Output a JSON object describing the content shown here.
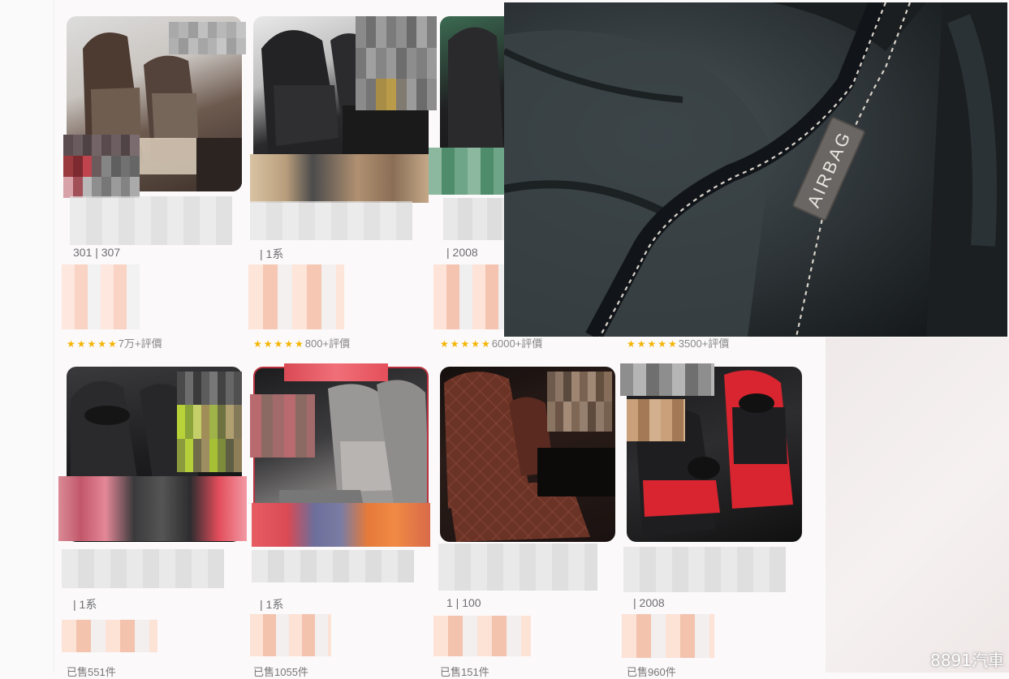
{
  "products_row1": [
    {
      "subtitle": "301 | 307",
      "rating_text": "7万+評價"
    },
    {
      "subtitle": "| 1系",
      "rating_text": "800+評價"
    },
    {
      "subtitle": "| 2008",
      "rating_text": "6000+評價"
    },
    {
      "subtitle": "",
      "rating_text": "3500+評價"
    }
  ],
  "products_row2": [
    {
      "subtitle": "| 1系",
      "sold_text": "已售551件"
    },
    {
      "subtitle": "| 1系",
      "sold_text": "已售1055件"
    },
    {
      "subtitle": "1 | 100",
      "sold_text": "已售151件"
    },
    {
      "subtitle": "| 2008",
      "sold_text": "已售960件"
    }
  ],
  "stars": "★★★★★",
  "overlay": {
    "tag_label": "AIRBAG"
  },
  "watermark": "8891汽車",
  "colors": {
    "star": "#f5b400",
    "accent_red": "#d8252f",
    "leather_brown": "#6b3326"
  }
}
